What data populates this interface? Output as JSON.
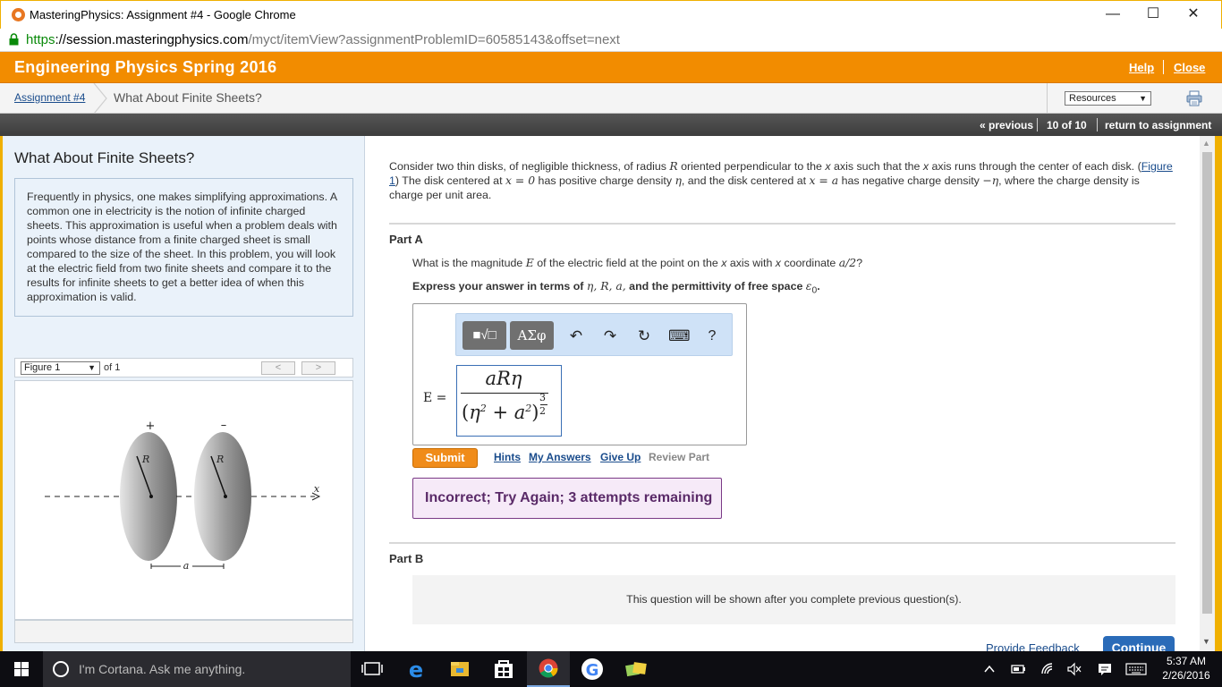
{
  "window": {
    "title": "MasteringPhysics: Assignment #4 - Google Chrome",
    "minimize": "—",
    "maximize": "☐",
    "close": "✕"
  },
  "address": {
    "scheme": "https",
    "host": "://session.masteringphysics.com",
    "path": "/myct/itemView?assignmentProblemID=60585143&offset=next"
  },
  "header": {
    "course": "Engineering Physics Spring 2016",
    "help": "Help",
    "close": "Close"
  },
  "breadcrumb": {
    "assignment": "Assignment #4",
    "current": "What About Finite Sheets?",
    "resources": "Resources"
  },
  "nav": {
    "previous": "« previous",
    "position": "10 of 10",
    "return": "return to assignment"
  },
  "left": {
    "title": "What About Finite Sheets?",
    "intro": "Frequently in physics, one makes simplifying approximations. A common one in electricity is the notion of infinite charged sheets. This approximation is useful when a problem deals with points whose distance from a finite charged sheet is small compared to the size of the sheet. In this problem, you will look at the electric field from two finite sheets and compare it to the results for infinite sheets to get a better idea of when this approximation is valid.",
    "figure_select": "Figure 1",
    "figure_of": "of 1",
    "prev": "<",
    "next": ">",
    "figure": {
      "plus": "+",
      "minus": "–",
      "r1": "R",
      "r2": "R",
      "x": "x",
      "a": "a"
    }
  },
  "problem": {
    "intro_1": "Consider two thin disks, of negligible thickness, of radius ",
    "R": "R",
    "intro_2": " oriented perpendicular to the ",
    "x1": "x",
    "intro_3": " axis such that the ",
    "x2": "x",
    "intro_4": " axis runs through the center of each disk. (",
    "figure_link": "Figure 1",
    "intro_5": ") The disk centered at ",
    "eq0": "x = 0",
    "intro_6": " has positive charge density ",
    "eta": "η",
    "intro_7": ", and the disk centered at ",
    "eqa": "x = a",
    "intro_8": " has negative charge density ",
    "neta": "−η",
    "intro_9": ", where the charge density is charge per unit area."
  },
  "partA": {
    "title": "Part A",
    "q1": "What is the magnitude ",
    "E": "E",
    "q2": " of the electric field at the point on the ",
    "x1": "x",
    "q3": " axis with ",
    "x2": "x",
    "q4": " coordinate ",
    "a2": "a/2",
    "q5": "?",
    "instr1": "Express your answer in terms of ",
    "vars": "η, R, a,",
    "instr2": " and the permittivity of free space ",
    "eps": "ε",
    "eps_sub": "0",
    "instr3": ".",
    "toolbar": {
      "template": "■√□",
      "greek": "ΑΣφ",
      "undo": "↶",
      "redo": "↷",
      "reset": "↻",
      "keyboard": "⌨",
      "help": "?"
    },
    "answer_label": "E =",
    "answer": {
      "numerator": "aRη",
      "den_open": "(",
      "den_eta": "η",
      "den_sq1": "2",
      "den_plus": " + ",
      "den_a": "a",
      "den_sq2": "2",
      "den_close": ")",
      "exp_num": "3",
      "exp_den": "2"
    },
    "submit": "Submit",
    "hints": "Hints",
    "my_answers": "My Answers",
    "give_up": "Give Up",
    "review": "Review Part",
    "feedback": "Incorrect; Try Again; 3 attempts remaining"
  },
  "partB": {
    "title": "Part B",
    "message": "This question will be shown after you complete previous question(s)."
  },
  "footer": {
    "feedback": "Provide Feedback",
    "continue": "Continue"
  },
  "taskbar": {
    "cortana": "I'm Cortana. Ask me anything.",
    "time": "5:37 AM",
    "date": "2/26/2016"
  }
}
